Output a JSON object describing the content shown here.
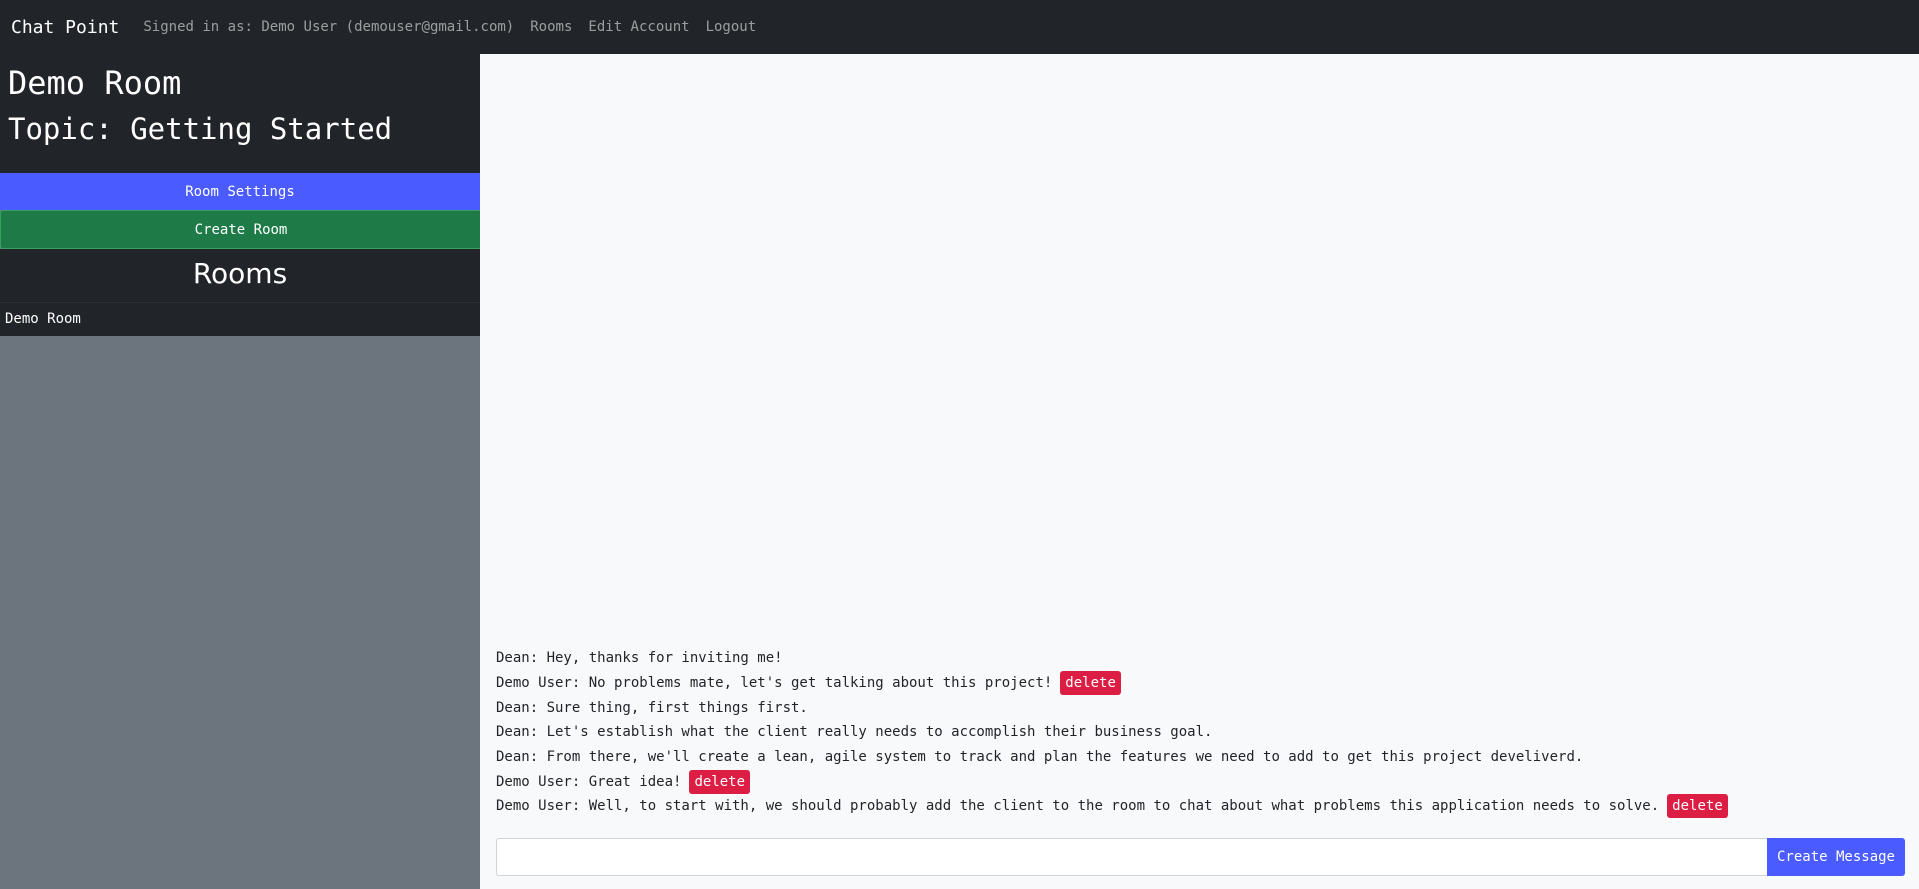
{
  "navbar": {
    "brand": "Chat Point",
    "signed_in": "Signed in as: Demo User (demouser@gmail.com)",
    "links": [
      "Rooms",
      "Edit Account",
      "Logout"
    ]
  },
  "room": {
    "title": "Demo Room",
    "topic": "Topic: Getting Started",
    "settings_label": "Room Settings",
    "create_room_label": "Create Room"
  },
  "rooms_list": {
    "heading": "Rooms",
    "items": [
      "Demo Room"
    ]
  },
  "messages": [
    {
      "text": "Dean: Hey, thanks for inviting me!",
      "deletable": false
    },
    {
      "text": "Demo User: No problems mate, let's get talking about this project!",
      "deletable": true
    },
    {
      "text": "Dean: Sure thing, first things first.",
      "deletable": false
    },
    {
      "text": "Dean: Let's establish what the client really needs to accomplish their business goal.",
      "deletable": false
    },
    {
      "text": "Dean: From there, we'll create a lean, agile system to track and plan the features we need to add to get this project develiverd.",
      "deletable": false
    },
    {
      "text": "Demo User: Great idea!",
      "deletable": true
    },
    {
      "text": "Demo User: Well, to start with, we should probably add the client to the room to chat about what problems this application needs to solve.",
      "deletable": true
    }
  ],
  "delete_label": "delete",
  "composer": {
    "value": "",
    "button_label": "Create Message"
  },
  "colors": {
    "navbar": "#212529",
    "primary": "#4a5cff",
    "success": "#1e7b48",
    "danger": "#dc1e45",
    "sidebar": "#6c757d"
  }
}
